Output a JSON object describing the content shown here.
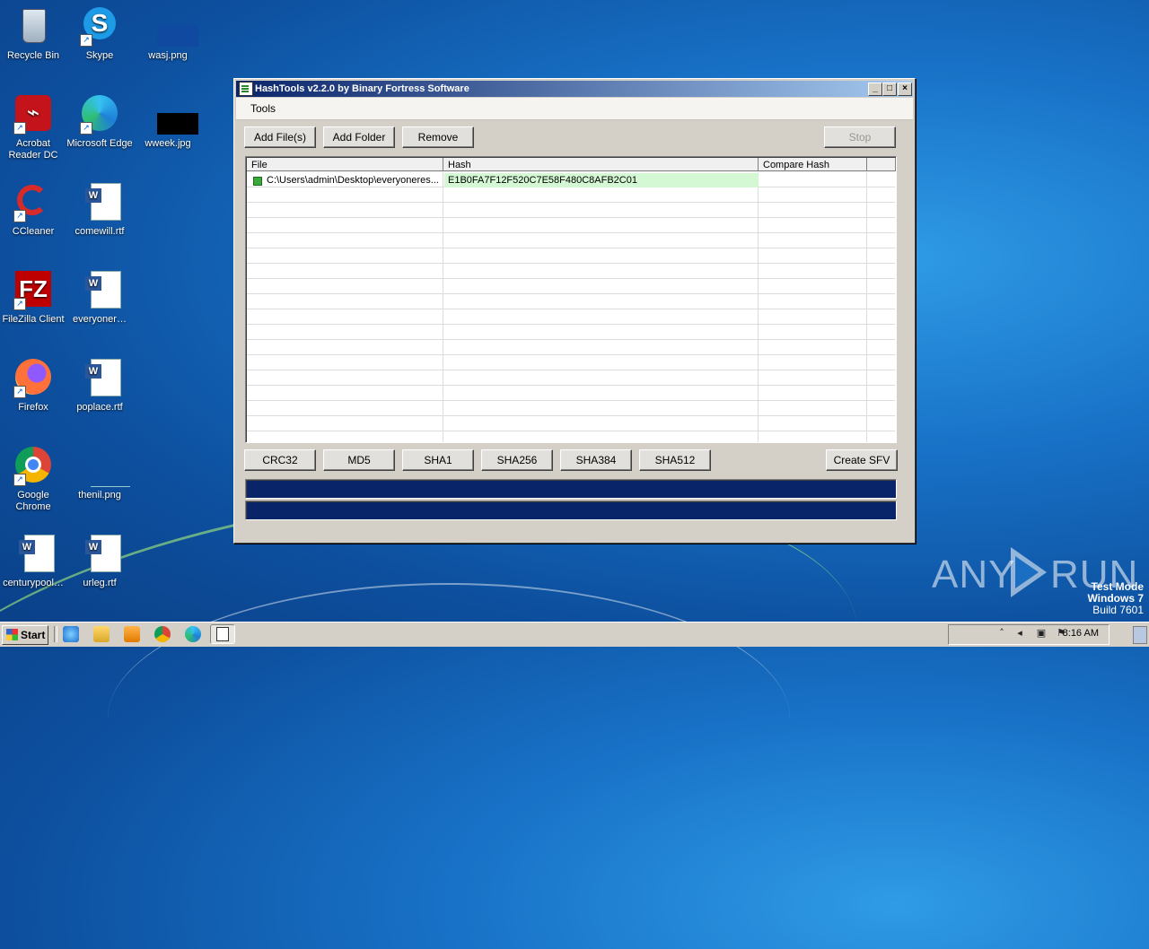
{
  "desktop": {
    "icons": [
      {
        "label": "Recycle Bin"
      },
      {
        "label": "Skype"
      },
      {
        "label": "wasj.png"
      },
      {
        "label": "Acrobat Reader DC"
      },
      {
        "label": "Microsoft Edge"
      },
      {
        "label": "wweek.jpg"
      },
      {
        "label": "CCleaner"
      },
      {
        "label": "comewill.rtf"
      },
      {
        "label": "FileZilla Client"
      },
      {
        "label": "everyoner…"
      },
      {
        "label": "Firefox"
      },
      {
        "label": "poplace.rtf"
      },
      {
        "label": "Google Chrome"
      },
      {
        "label": "thenil.png"
      },
      {
        "label": "centurypool…"
      },
      {
        "label": "urleg.rtf"
      }
    ],
    "brand": "ANY RUN",
    "watermark": {
      "line1": "Test Mode",
      "line2": "Windows 7",
      "line3": "Build 7601"
    }
  },
  "window": {
    "title": "HashTools v2.2.0 by Binary Fortress Software",
    "controls": {
      "minimize": "_",
      "maximize": "□",
      "close": "×"
    },
    "menu": [
      "Tools"
    ],
    "toolbar": {
      "add_files": "Add File(s)",
      "add_folder": "Add Folder",
      "remove": "Remove",
      "stop": "Stop"
    },
    "list": {
      "columns": [
        "File",
        "Hash",
        "Compare Hash"
      ],
      "rows": [
        {
          "file": "C:\\Users\\admin\\Desktop\\everyoneres...",
          "hash": "E1B0FA7F12F520C7E58F480C8AFB2C01",
          "compare": ""
        }
      ]
    },
    "hash_buttons": {
      "crc32": "CRC32",
      "md5": "MD5",
      "sha1": "SHA1",
      "sha256": "SHA256",
      "sha384": "SHA384",
      "sha512": "SHA512",
      "create_sfv": "Create SFV"
    },
    "progress": [
      100,
      100
    ]
  },
  "taskbar": {
    "start": "Start",
    "clock": "8:16 AM"
  }
}
